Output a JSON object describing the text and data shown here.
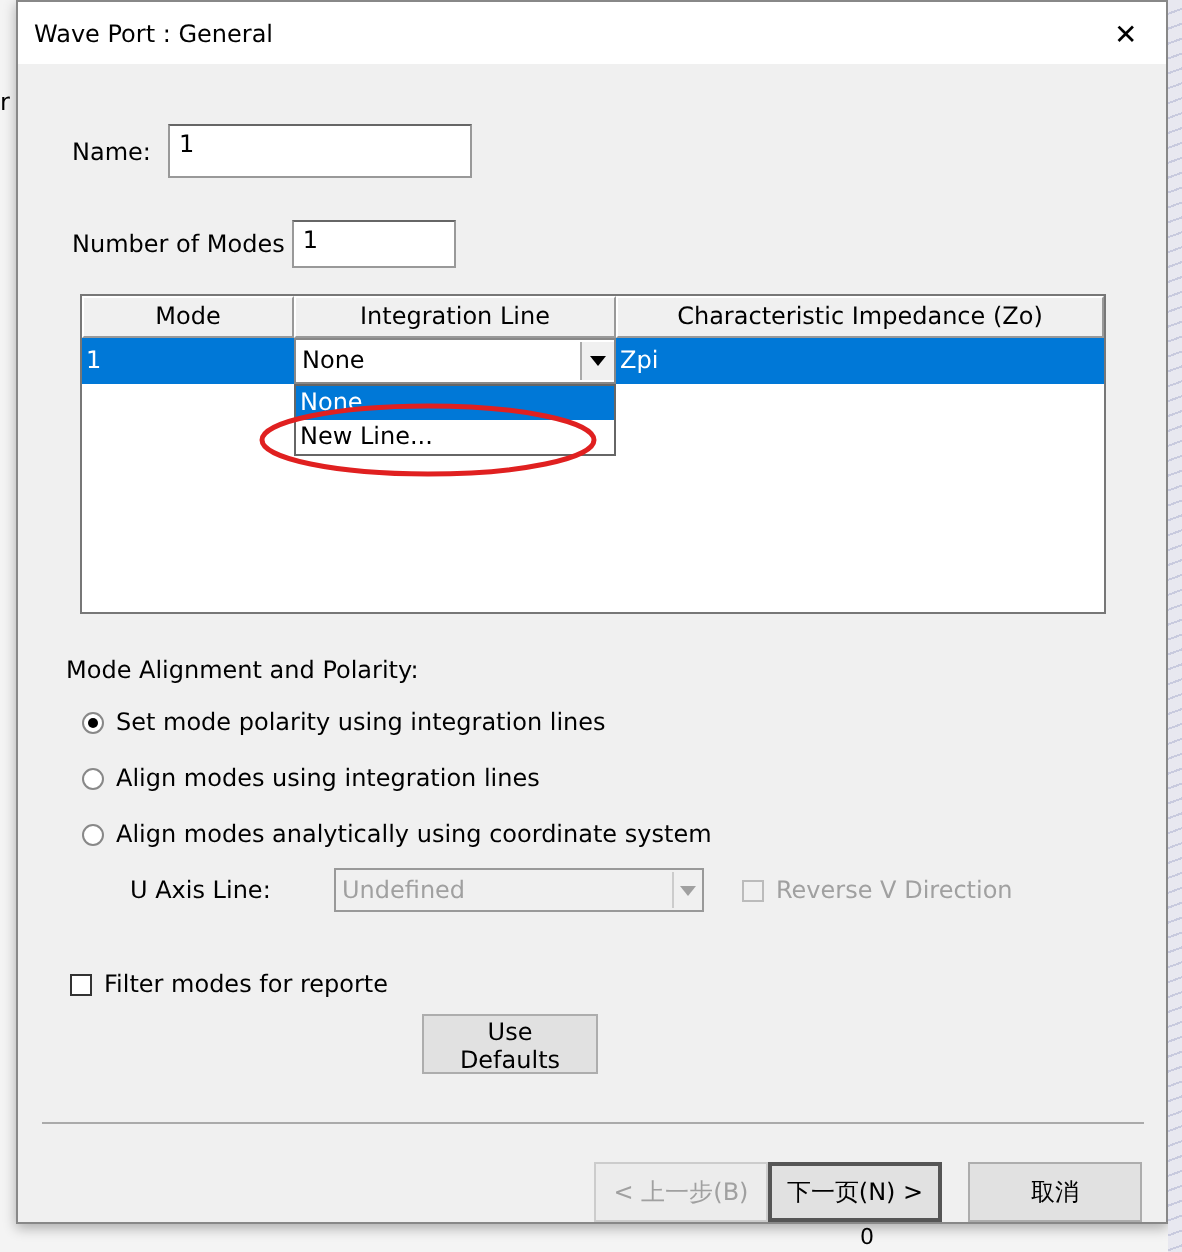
{
  "backdrop": {
    "texts": [
      "r",
      "0"
    ]
  },
  "window": {
    "title": "Wave Port : General",
    "close": "✕"
  },
  "name_field": {
    "label": "Name:",
    "value": "1"
  },
  "modes_field": {
    "label": "Number of Modes",
    "value": "1"
  },
  "table": {
    "columns": [
      "Mode",
      "Integration Line",
      "Characteristic Impedance (Zo)"
    ],
    "rows": [
      {
        "mode": "1",
        "integration_line": "None",
        "impedance": "Zpi",
        "selected": true
      }
    ],
    "dropdown": {
      "expanded": true,
      "options": [
        {
          "label": "None",
          "selected": true
        },
        {
          "label": "New Line...",
          "selected": false
        }
      ]
    }
  },
  "alignment": {
    "label": "Mode Alignment and Polarity:",
    "options": [
      {
        "label": "Set mode polarity using integration lines",
        "selected": true
      },
      {
        "label": "Align modes using integration lines",
        "selected": false
      },
      {
        "label": "Align modes analytically using coordinate system",
        "selected": false
      }
    ],
    "u_axis": {
      "label": "U Axis Line:",
      "value": "Undefined",
      "disabled": true
    },
    "reverse_v": {
      "label": "Reverse V Direction",
      "checked": false,
      "disabled": true
    }
  },
  "filter_modes": {
    "label": "Filter modes for reporte",
    "checked": false
  },
  "use_defaults": "Use Defaults",
  "buttons": [
    {
      "label": "< 上一步(B)",
      "disabled": true,
      "default": false
    },
    {
      "label": "下一页(N) >",
      "disabled": false,
      "default": true
    },
    {
      "label": "取消",
      "disabled": false,
      "default": false
    }
  ]
}
